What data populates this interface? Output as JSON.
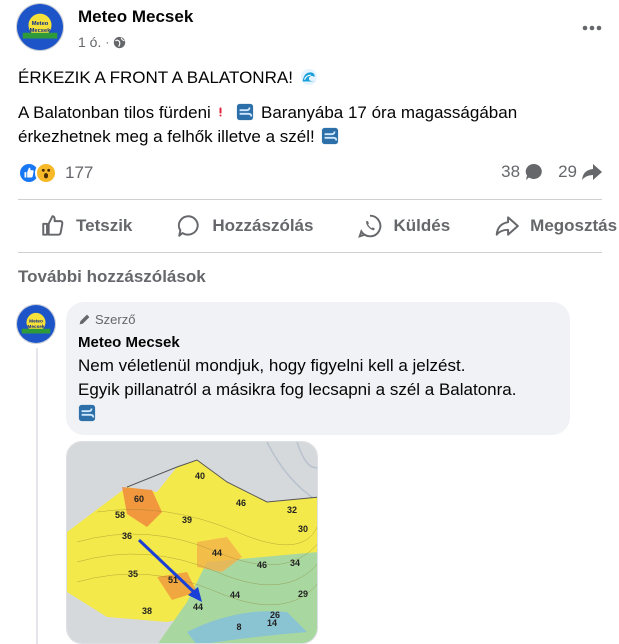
{
  "post": {
    "author": "Meteo Mecsek",
    "time": "1 ó.",
    "dot": "·",
    "avatar_logo_text": "Meteo Mecsek",
    "line1": "ÉRKEZIK A FRONT A BALATONRA!",
    "line2a": "A Balatonban tilos fürdeni",
    "line2b": "Baranyába 17 óra magasságában",
    "line2c": "érkezhetnek meg a felhők illetve a szél!"
  },
  "icons": {
    "wave": "wave-emoji-icon",
    "exclamation": "red-exclamation-icon",
    "wind": "wind-face-emoji-icon",
    "globe": "globe-icon",
    "more": "more-dots-icon"
  },
  "stats": {
    "reactions_count": "177",
    "comments_count": "38",
    "shares_count": "29",
    "reaction_types": [
      "like",
      "wow"
    ]
  },
  "actions": [
    {
      "label": "Tetszik",
      "icon": "like-icon"
    },
    {
      "label": "Hozzászólás",
      "icon": "comment-icon"
    },
    {
      "label": "Küldés",
      "icon": "whatsapp-icon"
    },
    {
      "label": "Megosztás",
      "icon": "share-icon"
    }
  ],
  "comments_section": {
    "more_label": "További hozzászólások"
  },
  "comment": {
    "badge": "Szerző",
    "author": "Meteo Mecsek",
    "text_line1": "Nem véletlenül mondjuk, hogy figyelni kell a jelzést.",
    "text_line2": "Egyik pillanatról a másikra fog lecsapni a szél a Balatonra."
  },
  "map": {
    "labels": [
      {
        "id": "l40",
        "text": "40"
      },
      {
        "id": "l60",
        "text": "60"
      },
      {
        "id": "l58",
        "text": "58"
      },
      {
        "id": "l46a",
        "text": "46"
      },
      {
        "id": "l39",
        "text": "39"
      },
      {
        "id": "l32",
        "text": "32"
      },
      {
        "id": "l30",
        "text": "30"
      },
      {
        "id": "l44a",
        "text": "44"
      },
      {
        "id": "l36",
        "text": "36"
      },
      {
        "id": "l35",
        "text": "35"
      },
      {
        "id": "l46b",
        "text": "46"
      },
      {
        "id": "l34",
        "text": "34"
      },
      {
        "id": "l51",
        "text": "51"
      },
      {
        "id": "l29",
        "text": "29"
      },
      {
        "id": "l38",
        "text": "38"
      },
      {
        "id": "l44b",
        "text": "44"
      },
      {
        "id": "l44c",
        "text": "44"
      },
      {
        "id": "l26",
        "text": "26"
      },
      {
        "id": "l8",
        "text": "8"
      },
      {
        "id": "l14",
        "text": "14"
      }
    ],
    "colors": {
      "yellow": "#f4e94a",
      "green": "#a8d8a0",
      "orange": "#f08a3c",
      "arrow": "#1a3fd6"
    }
  }
}
